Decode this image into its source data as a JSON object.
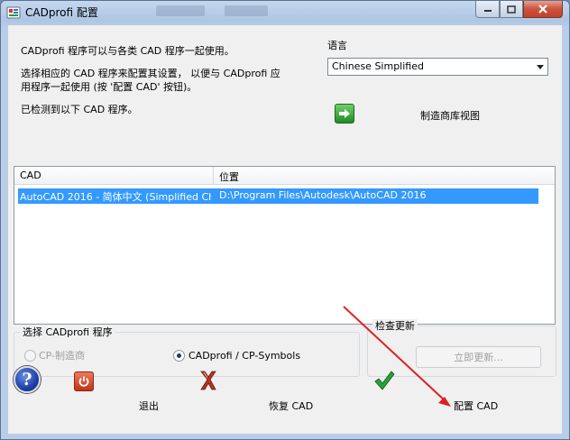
{
  "window": {
    "title": "CADprofi 配置",
    "controls": [
      "minimize",
      "maximize",
      "close"
    ]
  },
  "intro": {
    "line1": "CADprofi 程序可以与各类 CAD 程序一起使用。",
    "line2": "选择相应的 CAD 程序来配置其设置， 以便与 CADprofi 应",
    "line3": "用程序一起使用 (按 '配置 CAD' 按钮)。",
    "line4": "已检测到以下 CAD 程序。"
  },
  "language": {
    "label": "语言",
    "selected": "Chinese Simplified"
  },
  "create_view": {
    "label": "制造商库视图",
    "icon": "green-arrow-right-icon"
  },
  "cad_list": {
    "columns": [
      "CAD",
      "位置"
    ],
    "rows": [
      {
        "cad": "AutoCAD 2016 - 简体中文 (Simplified Chi...",
        "location": "D:\\Program Files\\Autodesk\\AutoCAD 2016",
        "selected": true
      }
    ]
  },
  "program_group": {
    "label": "选择 CADprofi 程序",
    "option_manufacturer": "CP-制造商",
    "option_symbols": "CADprofi / CP-Symbols",
    "selected": "CADprofi / CP-Symbols"
  },
  "update_group": {
    "label": "检查更新",
    "button": "立即更新..."
  },
  "bottom_bar": {
    "help_icon": "help-icon",
    "exit_label": "退出",
    "restore_label": "恢复 CAD",
    "configure_label": "配置 CAD"
  },
  "colors": {
    "selection": "#3399ff",
    "annotation_arrow": "#e02020"
  }
}
